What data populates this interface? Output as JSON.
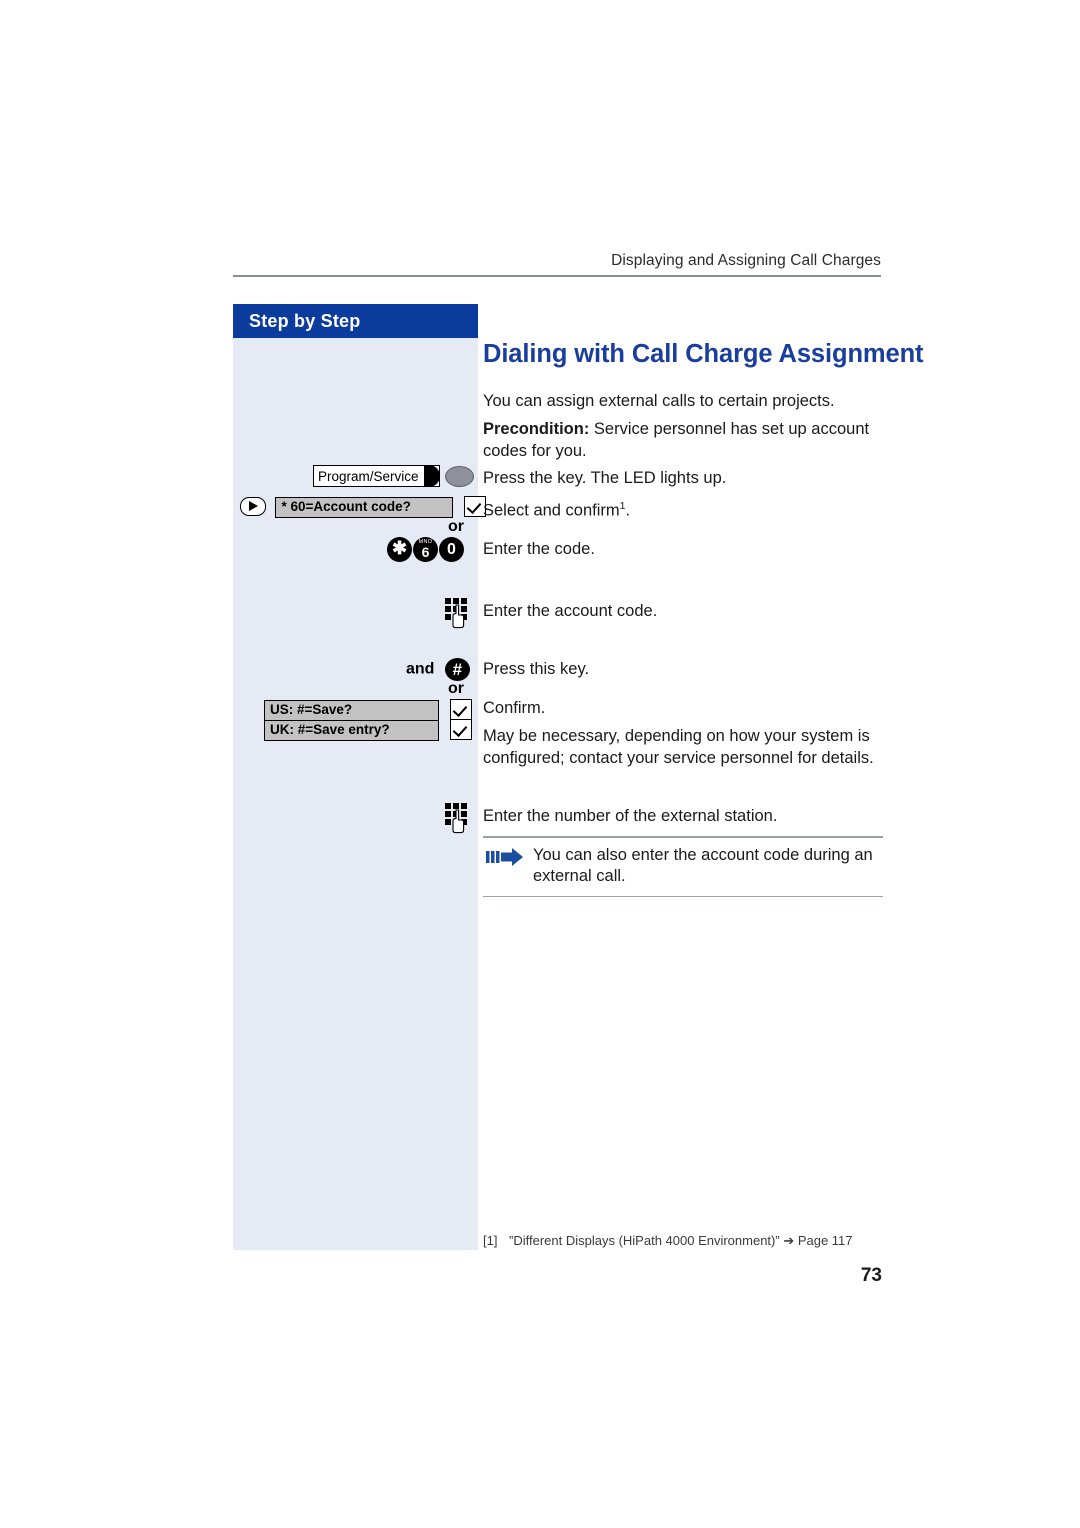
{
  "header": {
    "running_head": "Displaying and Assigning Call Charges"
  },
  "sidebar": {
    "title": "Step by Step",
    "rows": [
      {
        "id": "program-service",
        "key_label": "Program/Service",
        "led_icon": "led-indicator-icon"
      },
      {
        "id": "account-code-select",
        "select_icon": "select-key-icon",
        "display_text": "* 60=Account code?",
        "ok_icon": "checkmark-key-icon",
        "connector": "or"
      },
      {
        "id": "code-digits",
        "keys": [
          {
            "digit": "✱",
            "letters": ""
          },
          {
            "digit": "6",
            "letters": "MNO"
          },
          {
            "digit": "0",
            "letters": ""
          }
        ]
      },
      {
        "id": "enter-account-code",
        "keypad_icon": "dial-keypad-icon"
      },
      {
        "id": "hash-key",
        "and_label": "and",
        "hash_icon": "hash-key-icon",
        "connector": "or"
      },
      {
        "id": "save-us",
        "display_text": "US: #=Save?",
        "ok_icon": "checkmark-key-icon"
      },
      {
        "id": "save-uk",
        "display_text": "UK: #=Save entry?",
        "ok_icon": "checkmark-key-icon"
      },
      {
        "id": "enter-external-number",
        "keypad_icon": "dial-keypad-icon"
      }
    ]
  },
  "main": {
    "title": "Dialing with Call Charge Assignment",
    "paragraphs": {
      "intro": "You can assign external calls to certain projects.",
      "precondition_label": "Precondition:",
      "precondition_text": " Service personnel has set up account codes for you.",
      "press_key": "Press the key. The LED lights up.",
      "select_confirm": "Select and confirm",
      "select_confirm_footnote_marker": "1",
      "select_confirm_tail": ".",
      "enter_code": "Enter the code.",
      "enter_account_code": "Enter the account code.",
      "press_this_key": "Press this key.",
      "confirm": "Confirm.",
      "may_be_necessary": "May be necessary, depending on how your system is configured; contact your service personnel for details.",
      "enter_external_number": "Enter the number of the external station."
    },
    "note": {
      "icon": "blue-arrow-note-icon",
      "text": "You can also enter the account code during an external call."
    }
  },
  "footer": {
    "footnote_number": "[1]",
    "footnote_text": "”Different Displays (HiPath 4000 Environment)” ➔ Page 117",
    "page_number": "73"
  },
  "colors": {
    "brand_blue": "#0b3b9c",
    "title_blue": "#1a3e9e",
    "sidebar_bg": "#e6eaf4",
    "display_gray": "#c2c2c2",
    "rule_gray": "#8a8f96"
  }
}
